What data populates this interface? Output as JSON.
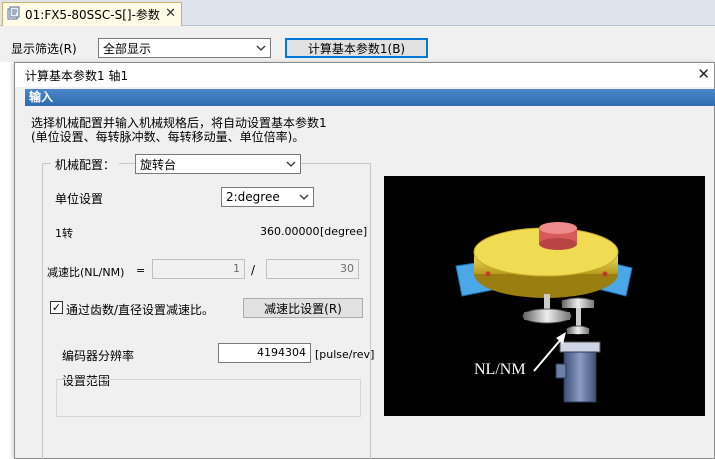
{
  "tab": {
    "title": "01:FX5-80SSC-S[]-参数",
    "close_glyph": "✕",
    "icon": "parameter-icon"
  },
  "filter": {
    "label": "显示筛选(R)",
    "value": "全部显示",
    "calc_button": "计算基本参数1(B)"
  },
  "dialog": {
    "title": "计算基本参数1 轴1",
    "close_glyph": "✕",
    "section": "输入",
    "description_lines": [
      "选择机械配置并输入机械规格后，将自动设置基本参数1",
      "(单位设置、每转脉冲数、每转移动量、单位倍率)。"
    ],
    "machine_config": {
      "label": "机械配置：",
      "value": "旋转台"
    },
    "unit_setting": {
      "label": "单位设置",
      "value": "2:degree"
    },
    "one_turn": {
      "label": "1转",
      "value": "360.00000",
      "unit": "[degree]"
    },
    "reduction_ratio": {
      "label": "减速比(NL/NM)",
      "equals": "=",
      "numerator": "1",
      "slash": "/",
      "denominator": "30"
    },
    "gear_checkbox": {
      "label": "通过齿数/直径设置减速比。",
      "checked": true,
      "check_glyph": "✓"
    },
    "reduction_button": "减速比设置(R)",
    "encoder": {
      "label": "编码器分辨率",
      "value": "4194304",
      "unit": "[pulse/rev]"
    },
    "range": {
      "label": "设置范围"
    },
    "illustration": {
      "annotation": "NL/NM"
    }
  },
  "colors": {
    "section_bar": "#3a78bd",
    "table_top": "#e8d23c",
    "plate": "#4aa8e8",
    "knob": "#e06a6a",
    "motor": "#6c7fa6"
  }
}
